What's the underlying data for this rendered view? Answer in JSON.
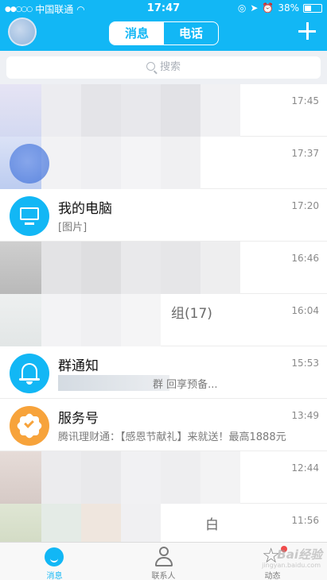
{
  "status_bar": {
    "carrier": "中国联通",
    "time": "17:47",
    "battery": "38%"
  },
  "header": {
    "tabs": [
      {
        "label": "消息",
        "active": true
      },
      {
        "label": "电话",
        "active": false
      }
    ]
  },
  "search": {
    "placeholder": "搜索"
  },
  "conversations": [
    {
      "title": "",
      "subtitle": "",
      "time": "17:45"
    },
    {
      "title": "",
      "subtitle": "",
      "time": "17:37"
    },
    {
      "title": "我的电脑",
      "subtitle": "[图片]",
      "time": "17:20"
    },
    {
      "title": "",
      "subtitle": "",
      "time": "16:46"
    },
    {
      "title": "组(17)",
      "subtitle": "",
      "time": "16:04"
    },
    {
      "title": "群通知",
      "subtitle": "群 回享预备...",
      "time": "15:53"
    },
    {
      "title": "服务号",
      "subtitle": "腾讯理财通：【感恩节献礼】来就送！最高1888元",
      "time": "13:49"
    },
    {
      "title": "",
      "subtitle": "",
      "time": "12:44"
    },
    {
      "title": "",
      "subtitle": "白",
      "time": "11:56"
    }
  ],
  "tabbar": [
    {
      "label": "消息",
      "active": true
    },
    {
      "label": "联系人",
      "active": false
    },
    {
      "label": "动态",
      "active": false
    }
  ],
  "watermark": {
    "text": "Bai经验",
    "sub": "jingyan.baidu.com"
  },
  "colors": {
    "accent": "#12B7F5",
    "service": "#F7A33B"
  }
}
